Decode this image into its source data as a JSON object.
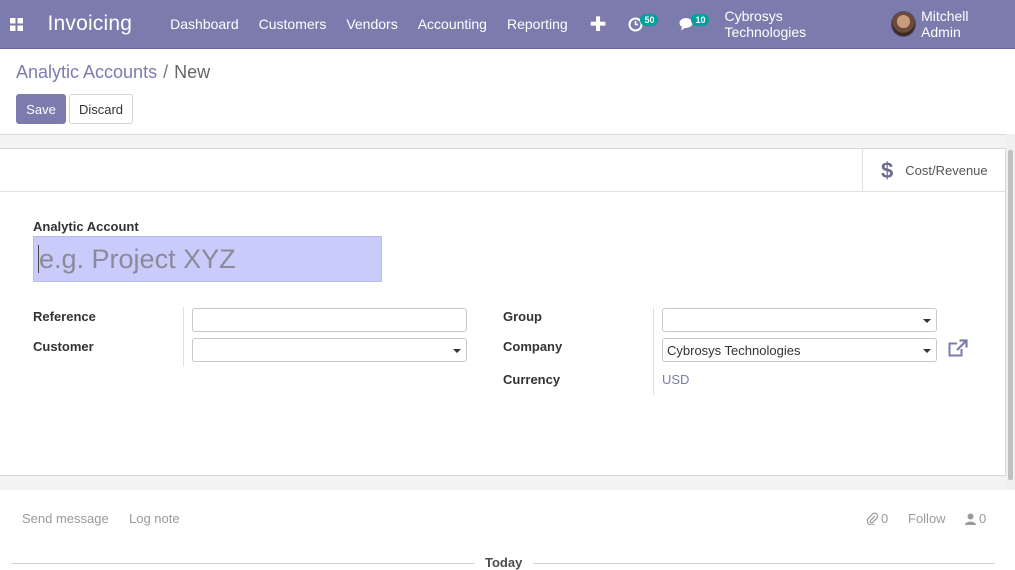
{
  "navbar": {
    "app_name": "Invoicing",
    "menu": [
      "Dashboard",
      "Customers",
      "Vendors",
      "Accounting",
      "Reporting"
    ],
    "plus_label": "✚",
    "activity_count": "50",
    "message_count": "10",
    "company": "Cybrosys Technologies",
    "user": "Mitchell Admin"
  },
  "breadcrumb": {
    "parent": "Analytic Accounts",
    "separator": "/",
    "current": "New"
  },
  "actions": {
    "save": "Save",
    "discard": "Discard"
  },
  "stat_button": {
    "icon": "dollar-icon",
    "label": "Cost/Revenue"
  },
  "form": {
    "title_label": "Analytic Account",
    "title_placeholder": "e.g. Project XYZ",
    "reference_label": "Reference",
    "reference_value": "",
    "customer_label": "Customer",
    "customer_value": "",
    "group_label": "Group",
    "group_value": "",
    "company_label": "Company",
    "company_value": "Cybrosys Technologies",
    "currency_label": "Currency",
    "currency_value": "USD"
  },
  "chatter": {
    "send_message": "Send message",
    "log_note": "Log note",
    "attachments_count": "0",
    "follow": "Follow",
    "followers_count": "0",
    "date_separator": "Today"
  },
  "colors": {
    "brand": "#7c7bad",
    "title_input_bg": "#c9cbfa",
    "badge": "#00a09d"
  }
}
